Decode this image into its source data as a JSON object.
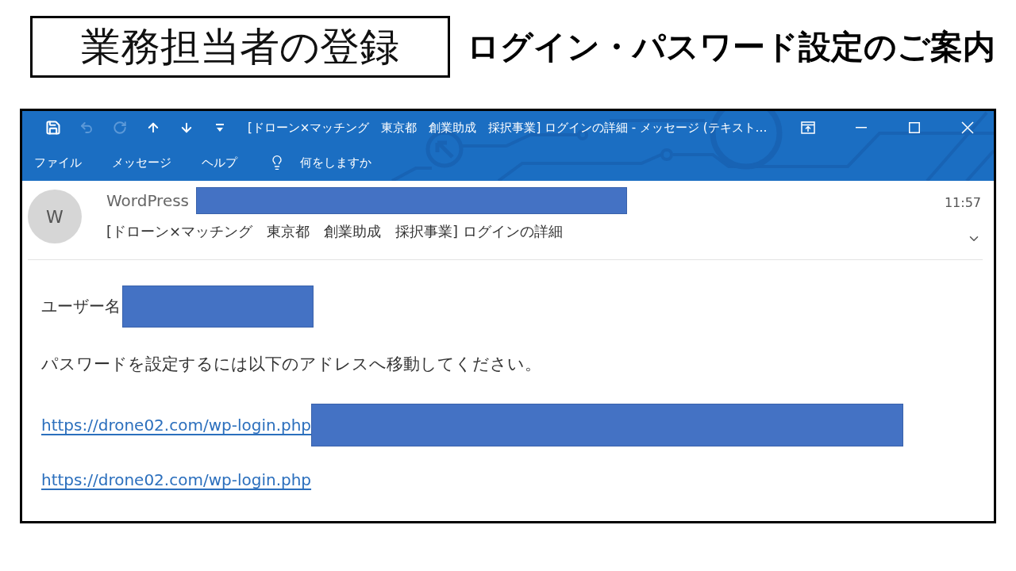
{
  "slide": {
    "title": "業務担当者の登録",
    "heading": "ログイン・パスワード設定のご案内"
  },
  "window": {
    "title": "[ドローン×マッチング　東京都　創業助成　採択事業] ログインの詳細 - メッセージ (テキスト…",
    "quick_access": [
      {
        "kind": "save",
        "disabled": false
      },
      {
        "kind": "undo",
        "disabled": true
      },
      {
        "kind": "redo",
        "disabled": true
      },
      {
        "kind": "up",
        "disabled": false
      },
      {
        "kind": "down",
        "disabled": false
      },
      {
        "kind": "customize",
        "disabled": false
      }
    ],
    "controls": [
      {
        "kind": "ribbon"
      },
      {
        "kind": "minimize"
      },
      {
        "kind": "maximize"
      },
      {
        "kind": "close"
      }
    ]
  },
  "menu": {
    "items": [
      {
        "label": "ファイル"
      },
      {
        "label": "メッセージ"
      },
      {
        "label": "ヘルプ"
      }
    ],
    "search": {
      "placeholder": "何をしますか"
    }
  },
  "message": {
    "avatar": "W",
    "sender": {
      "name": "WordPress",
      "redacted": true
    },
    "time": "11:57",
    "subject": "[ドローン×マッチング　東京都　創業助成　採択事業] ログインの詳細"
  },
  "body": {
    "username": {
      "label": "ユーザー名",
      "redacted": true
    },
    "instruction": "パスワードを設定するには以下のアドレスへ移動してください。",
    "links": [
      {
        "url": "https://drone02.com/wp-login.php",
        "redacted": true
      },
      {
        "url": "https://drone02.com/wp-login.php",
        "redacted": false
      }
    ]
  }
}
